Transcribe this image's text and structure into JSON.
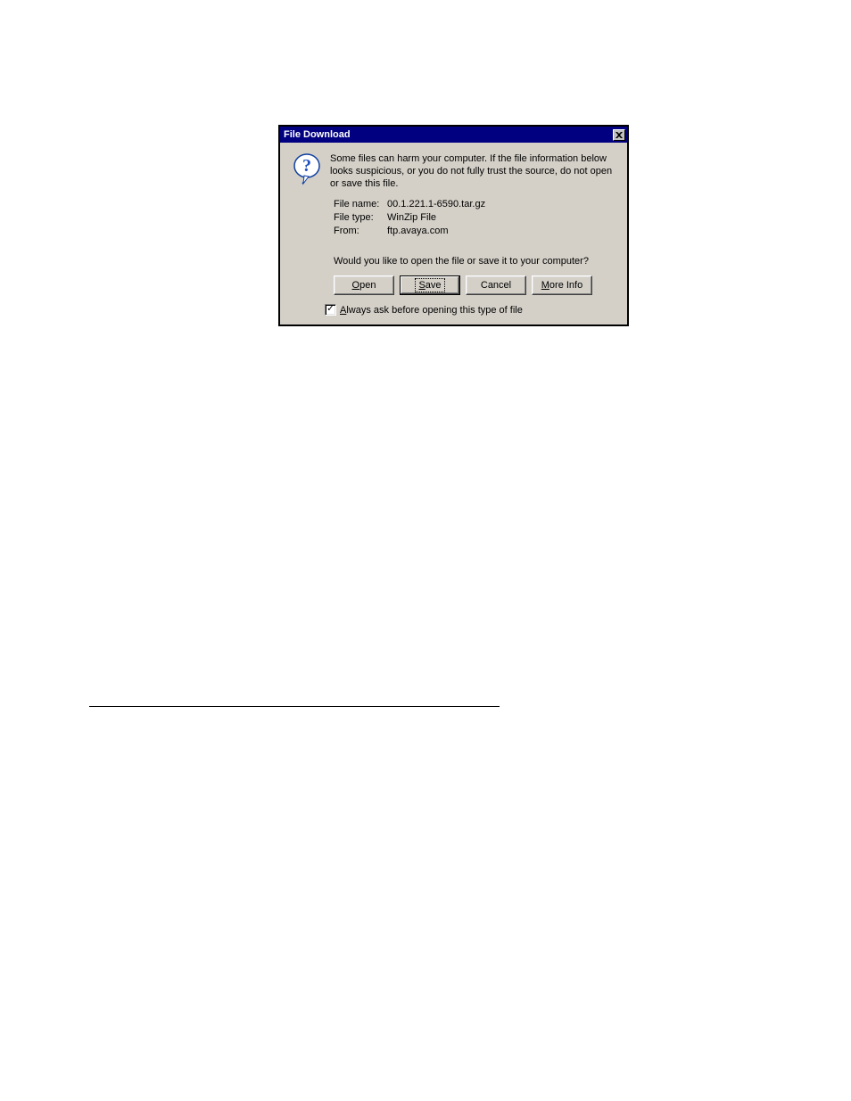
{
  "dialog": {
    "title": "File Download",
    "warning": "Some files can harm your computer. If the file information below looks suspicious, or you do not fully trust the source, do not open or save this file.",
    "info": {
      "filename_label": "File name:",
      "filename_value": "00.1.221.1-6590.tar.gz",
      "filetype_label": "File type:",
      "filetype_value": "WinZip File",
      "from_label": "From:",
      "from_value": "ftp.avaya.com"
    },
    "prompt": "Would you like to open the file or save it to your computer?",
    "buttons": {
      "open": "Open",
      "save": "Save",
      "cancel": "Cancel",
      "more_info": "More Info"
    },
    "checkbox": {
      "checked": true,
      "label": "Always ask before opening this type of file"
    }
  },
  "icon": {
    "name": "question-icon"
  }
}
